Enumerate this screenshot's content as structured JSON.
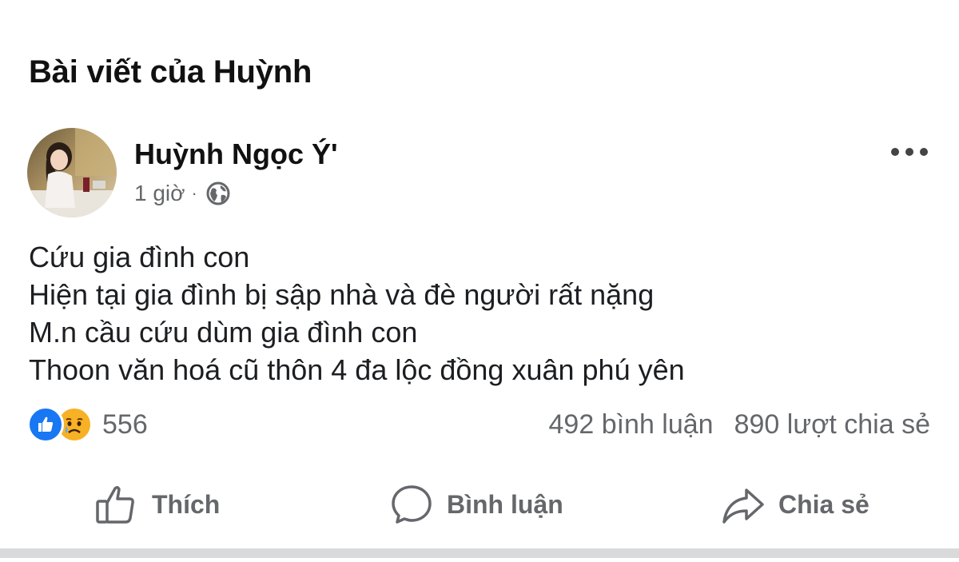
{
  "header": {
    "title": "Bài viết của Huỳnh"
  },
  "post": {
    "author": {
      "name": "Huỳnh Ngọc Ý'",
      "avatar_icon": "profile-photo"
    },
    "time": "1 giờ",
    "separator": "·",
    "privacy_icon": "globe-icon",
    "lines": [
      "Cứu gia đình con",
      "Hiện tại gia đình bị sập nhà và đè người rất nặng",
      "M.n cầu cứu dùm gia đình con",
      "Thoon văn hoá cũ thôn 4 đa lộc đồng xuân phú yên"
    ],
    "reactions": {
      "count": "556",
      "icons": [
        "like-icon",
        "sad-icon"
      ]
    },
    "comments": "492 bình luận",
    "shares": "890 lượt chia sẻ"
  },
  "actions": {
    "like": "Thích",
    "comment": "Bình luận",
    "share": "Chia sẻ"
  },
  "colors": {
    "like_blue": "#1877f2",
    "sad_yellow": "#f7b125",
    "secondary_text": "#65676b",
    "divider": "#d9dadc"
  }
}
